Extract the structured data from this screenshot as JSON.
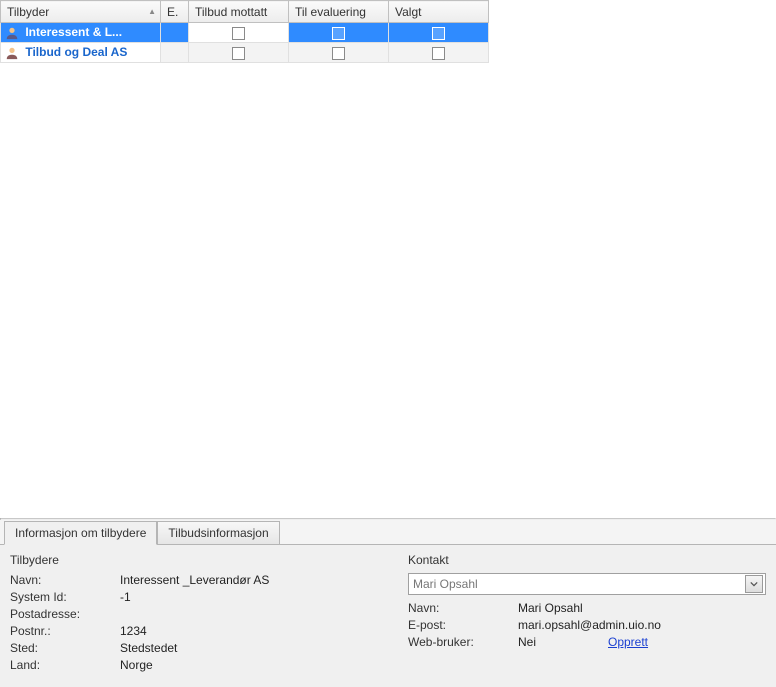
{
  "table": {
    "columns": {
      "tilbyder": "Tilbyder",
      "e": "E.",
      "tilbud_mottatt": "Tilbud mottatt",
      "til_evaluering": "Til evaluering",
      "valgt": "Valgt"
    },
    "rows": [
      {
        "name": "Interessent & L...",
        "selected": true
      },
      {
        "name": "Tilbud og Deal AS",
        "selected": false
      }
    ]
  },
  "tabs": {
    "info_tilbydere": "Informasjon om tilbydere",
    "tilbudsinfo": "Tilbudsinformasjon"
  },
  "tilbydere": {
    "group_label": "Tilbydere",
    "navn_label": "Navn:",
    "navn_value": "Interessent _Leverandør AS",
    "systemid_label": "System Id:",
    "systemid_value": "-1",
    "postadresse_label": "Postadresse:",
    "postadresse_value": "",
    "postnr_label": "Postnr.:",
    "postnr_value": "1234",
    "sted_label": "Sted:",
    "sted_value": "Stedstedet",
    "land_label": "Land:",
    "land_value": "Norge"
  },
  "kontakt": {
    "group_label": "Kontakt",
    "combo_value": "Mari Opsahl",
    "navn_label": "Navn:",
    "navn_value": "Mari Opsahl",
    "epost_label": "E-post:",
    "epost_value": "mari.opsahl@admin.uio.no",
    "webbruker_label": "Web-bruker:",
    "webbruker_value": "Nei",
    "opprett_link": "Opprett"
  }
}
